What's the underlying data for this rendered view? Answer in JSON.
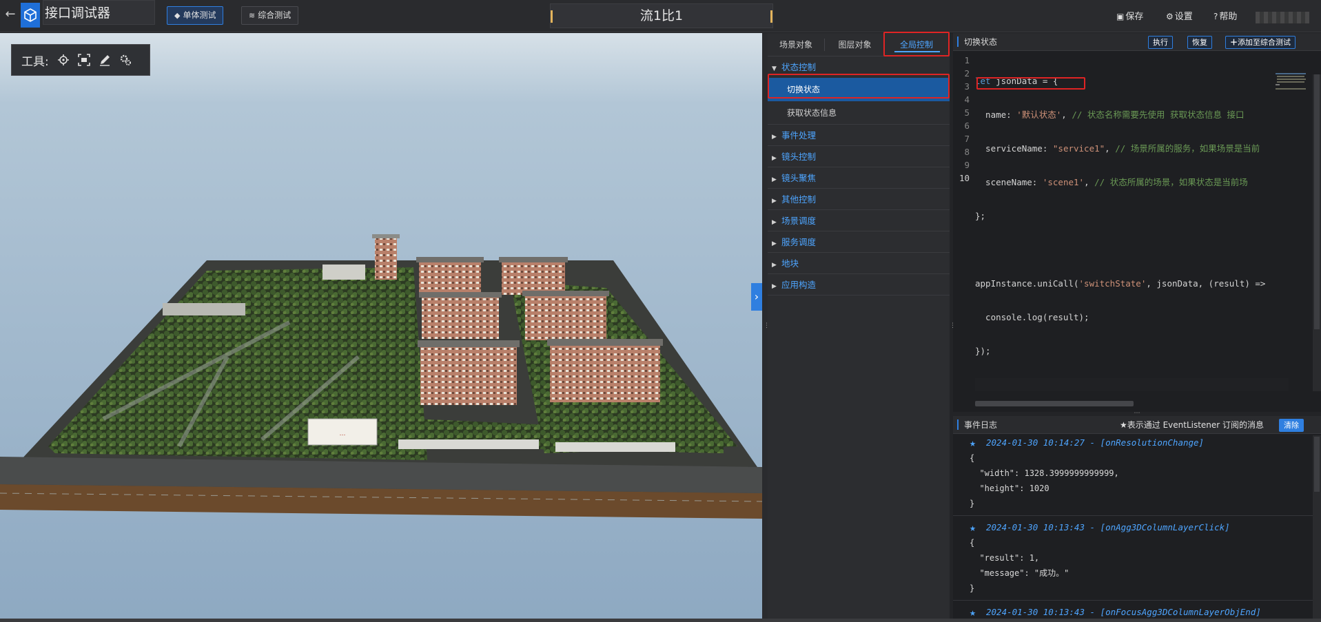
{
  "topbar": {
    "app_title": "接口调试器",
    "tabs": [
      {
        "label": "单体测试",
        "icon": "cube-icon",
        "active": true
      },
      {
        "label": "综合测试",
        "icon": "layers-icon",
        "active": false
      }
    ],
    "doc_title": "流1比1",
    "actions": [
      {
        "label": "保存",
        "icon": "save-icon"
      },
      {
        "label": "设置",
        "icon": "gear-icon"
      },
      {
        "label": "帮助",
        "icon": "help-icon"
      }
    ]
  },
  "viewport": {
    "toolbox_label": "工具:",
    "tools": [
      "locate-icon",
      "frame-icon",
      "pen-icon",
      "settings-icon"
    ],
    "billboard_text": "…"
  },
  "tree": {
    "tabs": [
      {
        "label": "场景对象",
        "active": false
      },
      {
        "label": "图层对象",
        "active": false
      },
      {
        "label": "全局控制",
        "active": true
      }
    ],
    "groups": [
      {
        "label": "状态控制",
        "expanded": true,
        "items": [
          {
            "label": "切换状态",
            "selected": true
          },
          {
            "label": "获取状态信息",
            "selected": false
          }
        ]
      },
      {
        "label": "事件处理",
        "expanded": false
      },
      {
        "label": "镜头控制",
        "expanded": false
      },
      {
        "label": "镜头聚焦",
        "expanded": false
      },
      {
        "label": "其他控制",
        "expanded": false
      },
      {
        "label": "场景调度",
        "expanded": false
      },
      {
        "label": "服务调度",
        "expanded": false
      },
      {
        "label": "地块",
        "expanded": false
      },
      {
        "label": "应用构造",
        "expanded": false
      }
    ]
  },
  "editor": {
    "title": "切换状态",
    "buttons": {
      "run": "执行",
      "reset": "恢复",
      "add": "添加至综合测试"
    },
    "line_numbers": [
      "1",
      "2",
      "3",
      "4",
      "5",
      "6",
      "7",
      "8",
      "9",
      "10"
    ]
  },
  "log": {
    "title": "事件日志",
    "note": "★表示通过 EventListener 订阅的消息",
    "clear": "清除",
    "entries": [
      {
        "head": "2024-01-30 10:14:27 - [onResolutionChange]",
        "lines": [
          "{",
          "  \"width\": 1328.3999999999999,",
          "  \"height\": 1020",
          "}"
        ]
      },
      {
        "head": "2024-01-30 10:13:43 - [onAgg3DColumnLayerClick]",
        "lines": [
          "{",
          "  \"result\": 1,",
          "  \"message\": \"成功。\"",
          "}"
        ]
      },
      {
        "head": "2024-01-30 10:13:43 - [onFocusAgg3DColumnLayerObjEnd]",
        "lines": []
      }
    ]
  }
}
